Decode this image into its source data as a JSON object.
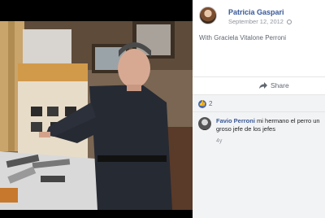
{
  "post": {
    "author": "Patricia Gaspari",
    "date": "September 12, 2012",
    "with_text": "With Graciela Vitalone Perroni"
  },
  "actions": {
    "share_label": "Share"
  },
  "reactions": {
    "count": "2"
  },
  "comment": {
    "author": "Favio Perroni",
    "text": "mi hermano el perro un groso jefe de los jefes",
    "time": "4y"
  },
  "colors": {
    "link_blue": "#385898",
    "like_blue": "#4267b2",
    "meta_gray": "#90949c"
  }
}
